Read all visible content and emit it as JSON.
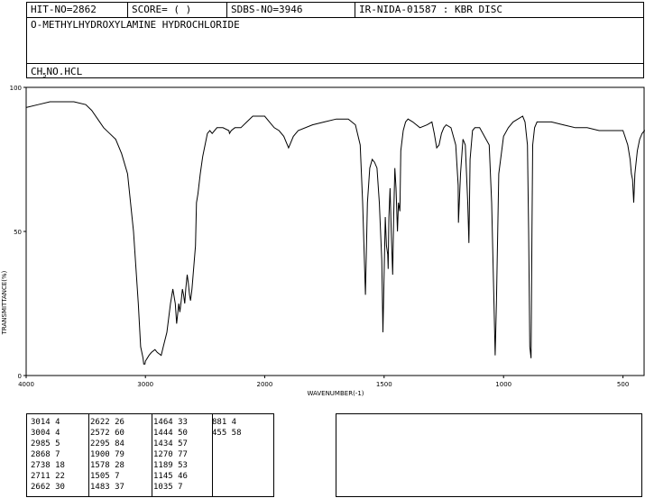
{
  "header": {
    "hit_no": "HIT-NO=2862",
    "score": "SCORE=  (   )",
    "sdbs_no": "SDBS-NO=3946",
    "ir_id": "IR-NIDA-01587 : KBR DISC",
    "compound": "O-METHYLHYDROXYLAMINE HYDROCHLORIDE",
    "formula": {
      "pre": "CH",
      "sub": "5",
      "post": "NO.HCL"
    }
  },
  "chart_data": {
    "type": "line",
    "xlabel": "WAVENUMBER(-1)",
    "ylabel": "TRANSMITTANCE(%)",
    "xlim": [
      4000,
      400
    ],
    "ylim": [
      0,
      100
    ],
    "x_ticks": [
      "4000",
      "3000",
      "2000",
      "1500",
      "1000",
      "500"
    ],
    "y_ticks": [
      "100",
      "50",
      "0"
    ],
    "series": [
      {
        "x": [
          4000,
          3900,
          3800,
          3700,
          3600,
          3500,
          3450,
          3400,
          3350,
          3300,
          3250,
          3200,
          3150,
          3100,
          3060,
          3040,
          3020,
          3014,
          3004,
          3000,
          2985,
          2970,
          2950,
          2920,
          2900,
          2868,
          2850,
          2820,
          2790,
          2770,
          2750,
          2738,
          2720,
          2711,
          2700,
          2690,
          2680,
          2670,
          2662,
          2650,
          2640,
          2630,
          2622,
          2610,
          2600,
          2590,
          2580,
          2572,
          2560,
          2540,
          2520,
          2500,
          2480,
          2460,
          2440,
          2400,
          2350,
          2300,
          2295,
          2280,
          2250,
          2200,
          2150,
          2100,
          2050,
          2000,
          1980,
          1960,
          1940,
          1920,
          1900,
          1880,
          1860,
          1800,
          1750,
          1700,
          1650,
          1620,
          1600,
          1590,
          1578,
          1570,
          1560,
          1550,
          1540,
          1530,
          1520,
          1510,
          1505,
          1500,
          1495,
          1490,
          1485,
          1483,
          1480,
          1475,
          1470,
          1464,
          1460,
          1455,
          1450,
          1444,
          1440,
          1434,
          1430,
          1420,
          1410,
          1400,
          1380,
          1350,
          1320,
          1300,
          1290,
          1280,
          1270,
          1260,
          1250,
          1240,
          1220,
          1200,
          1190,
          1189,
          1180,
          1170,
          1160,
          1150,
          1145,
          1140,
          1130,
          1120,
          1100,
          1080,
          1060,
          1050,
          1040,
          1035,
          1030,
          1020,
          1000,
          980,
          960,
          940,
          920,
          910,
          900,
          895,
          890,
          885,
          881,
          878,
          870,
          860,
          850,
          800,
          750,
          700,
          650,
          600,
          550,
          500,
          480,
          470,
          465,
          460,
          455,
          450,
          440,
          430,
          420,
          410,
          400
        ],
        "y": [
          93,
          94,
          95,
          95,
          95,
          94,
          92,
          89,
          86,
          84,
          82,
          77,
          70,
          50,
          25,
          10,
          6,
          4,
          4,
          5,
          6,
          7,
          8,
          9,
          8,
          7,
          10,
          15,
          25,
          30,
          25,
          18,
          25,
          22,
          26,
          30,
          28,
          25,
          30,
          35,
          32,
          28,
          26,
          30,
          35,
          40,
          45,
          60,
          63,
          70,
          76,
          80,
          84,
          85,
          84,
          86,
          86,
          85,
          84,
          85,
          86,
          86,
          88,
          90,
          90,
          90,
          88,
          86,
          85,
          83,
          79,
          83,
          85,
          87,
          88,
          89,
          89,
          87,
          80,
          60,
          28,
          60,
          72,
          75,
          74,
          72,
          60,
          40,
          15,
          35,
          55,
          45,
          42,
          37,
          55,
          65,
          50,
          35,
          55,
          72,
          65,
          50,
          60,
          57,
          78,
          85,
          88,
          89,
          88,
          86,
          87,
          88,
          84,
          79,
          80,
          84,
          86,
          87,
          86,
          80,
          66,
          53,
          70,
          82,
          80,
          60,
          46,
          75,
          85,
          86,
          86,
          83,
          80,
          60,
          25,
          7,
          25,
          70,
          83,
          86,
          88,
          89,
          90,
          88,
          80,
          50,
          10,
          6,
          50,
          80,
          86,
          88,
          88,
          88,
          87,
          86,
          86,
          85,
          85,
          85,
          80,
          75,
          70,
          68,
          60,
          70,
          78,
          82,
          84,
          85,
          85
        ]
      }
    ]
  },
  "peak_table": [
    {
      "wn": "3014",
      "t": "4"
    },
    {
      "wn": "3004",
      "t": "4"
    },
    {
      "wn": "2985",
      "t": "5"
    },
    {
      "wn": "2868",
      "t": "7"
    },
    {
      "wn": "2738",
      "t": "18"
    },
    {
      "wn": "2711",
      "t": "22"
    },
    {
      "wn": "2662",
      "t": "30"
    },
    {
      "wn": "2622",
      "t": "26"
    },
    {
      "wn": "2572",
      "t": "60"
    },
    {
      "wn": "2295",
      "t": "84"
    },
    {
      "wn": "1900",
      "t": "79"
    },
    {
      "wn": "1578",
      "t": "28"
    },
    {
      "wn": "1505",
      "t": "7"
    },
    {
      "wn": "1483",
      "t": "37"
    },
    {
      "wn": "1464",
      "t": "33"
    },
    {
      "wn": "1444",
      "t": "50"
    },
    {
      "wn": "1434",
      "t": "57"
    },
    {
      "wn": "1270",
      "t": "77"
    },
    {
      "wn": "1189",
      "t": "53"
    },
    {
      "wn": "1145",
      "t": "46"
    },
    {
      "wn": "1035",
      "t": "7"
    },
    {
      "wn": "881",
      "t": "4"
    },
    {
      "wn": "455",
      "t": "58"
    }
  ]
}
